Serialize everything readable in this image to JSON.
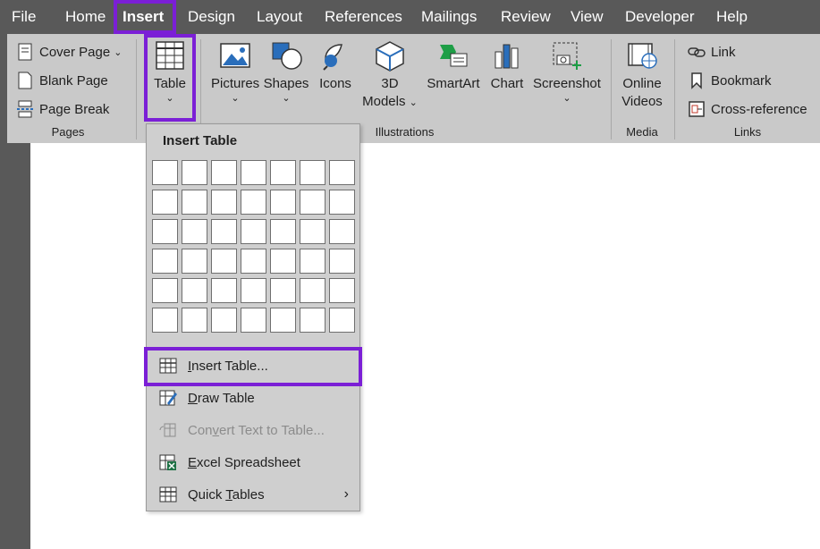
{
  "menubar": {
    "tabs": [
      "File",
      "Home",
      "Insert",
      "Design",
      "Layout",
      "References",
      "Mailings",
      "Review",
      "View",
      "Developer",
      "Help"
    ],
    "active_tab": "Insert"
  },
  "ribbon": {
    "pages": {
      "cover_page": "Cover Page",
      "blank_page": "Blank Page",
      "page_break": "Page Break",
      "label": "Pages"
    },
    "tables": {
      "table": "Table"
    },
    "illustrations": {
      "pictures": "Pictures",
      "shapes": "Shapes",
      "icons": "Icons",
      "models_line1": "3D",
      "models_line2": "Models",
      "smartart": "SmartArt",
      "chart": "Chart",
      "screenshot": "Screenshot",
      "label": "Illustrations"
    },
    "media": {
      "online_line1": "Online",
      "online_line2": "Videos",
      "label": "Media"
    },
    "links": {
      "link": "Link",
      "bookmark": "Bookmark",
      "cross_reference": "Cross-reference",
      "label": "Links"
    }
  },
  "dropdown": {
    "title": "Insert Table",
    "grid": {
      "columns": 7,
      "rows": 6
    },
    "items": {
      "insert_table": {
        "u": "I",
        "rest": "nsert Table..."
      },
      "draw_table": {
        "u": "D",
        "rest": "raw Table"
      },
      "convert": {
        "pre": "Con",
        "u": "v",
        "rest": "ert Text to Table..."
      },
      "excel": {
        "u": "E",
        "rest": "xcel Spreadsheet"
      },
      "quick": {
        "pre": "Quick ",
        "u": "T",
        "rest": "ables"
      }
    }
  },
  "colors": {
    "highlight": "#7b1fd6",
    "menubar": "#595959",
    "ribbon": "#c9c9c9"
  }
}
